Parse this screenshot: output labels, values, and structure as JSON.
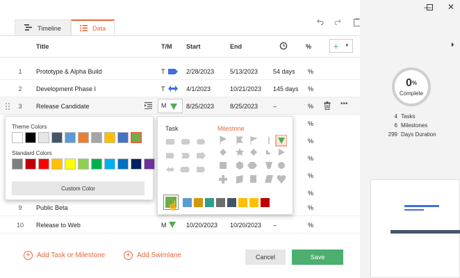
{
  "tabs": [
    {
      "label": "Timeline"
    },
    {
      "label": "Data"
    }
  ],
  "columns": {
    "title": "Title",
    "tm": "T/M",
    "start": "Start",
    "end": "End",
    "pct": "%"
  },
  "rows": [
    {
      "num": "1",
      "title": "Prototype & Alpha Build",
      "tm": "T",
      "start": "2/28/2023",
      "end": "5/13/2023",
      "duration": "54 days",
      "pct": "%"
    },
    {
      "num": "2",
      "title": "Development Phase I",
      "tm": "T",
      "start": "4/1/2023",
      "end": "10/21/2023",
      "duration": "145 days",
      "pct": "%"
    },
    {
      "num": "3",
      "title": "Release Candidate",
      "tm": "M",
      "start": "8/25/2023",
      "end": "8/25/2023",
      "duration": "–",
      "pct": "%"
    },
    {
      "pct": "%"
    },
    {
      "pct": "%"
    },
    {
      "pct": "%"
    },
    {
      "pct": "%"
    },
    {
      "pct": "%"
    },
    {
      "num": "9",
      "title": "Public Beta",
      "pct": "%"
    },
    {
      "num": "10",
      "title": "Release to Web",
      "tm": "M",
      "start": "10/20/2023",
      "end": "10/20/2023",
      "duration": "–",
      "pct": "%"
    }
  ],
  "colorPicker": {
    "theme_label": "Theme Colors",
    "standard_label": "Standard Colors",
    "custom_label": "Custom Color",
    "theme": [
      "#ffffff",
      "#000000",
      "#e7e6e6",
      "#44546a",
      "#5b9bd5",
      "#ed7d31",
      "#a5a5a5",
      "#ffc000",
      "#4472c4",
      "#70ad47"
    ],
    "standard": [
      "#7f7f7f",
      "#c00000",
      "#ff0000",
      "#ffc000",
      "#ffff00",
      "#92d050",
      "#00b050",
      "#00b0f0",
      "#0070c0",
      "#002060",
      "#7030a0"
    ]
  },
  "shapePicker": {
    "task_label": "Task",
    "milestone_label": "Milestone",
    "colors": [
      "#70ad47",
      "#5b9bd5",
      "#d4970a",
      "#2e9d8f",
      "#6e6e6e",
      "#44546a",
      "#ffc000",
      "#ffc000",
      "#c00000"
    ]
  },
  "footer": {
    "add_task": "Add Task or Milestone",
    "add_swimlane": "Add Swimlane",
    "cancel": "Cancel",
    "save": "Save"
  },
  "summary": {
    "percent": "0",
    "percent_sign": "%",
    "complete": "Complete",
    "tasks_count": "4",
    "tasks_label": "Tasks",
    "milestones_count": "6",
    "milestones_label": "Milestones",
    "days_count": "299",
    "days_label": "Days Duration"
  },
  "colors": {
    "accent": "#e8663a",
    "save": "#4caf70",
    "task_blue": "#3f6fd6",
    "milestone_green": "#4caf50"
  }
}
